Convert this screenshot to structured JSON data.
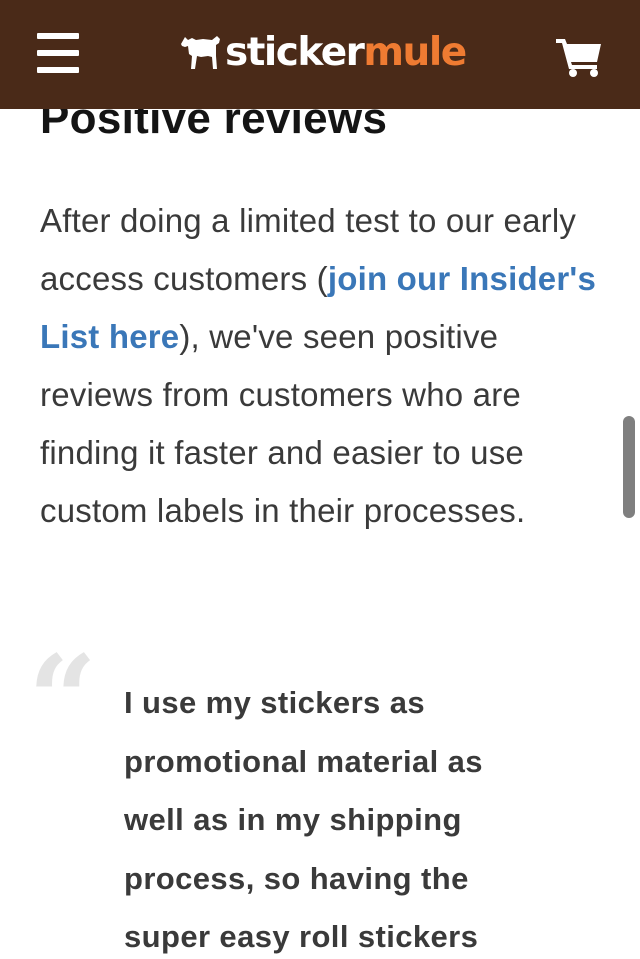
{
  "header": {
    "menu_icon": "hamburger-menu-icon",
    "logo": {
      "icon": "mule-icon",
      "word_sticker": "sticker",
      "word_mule": "mule"
    },
    "cart_icon": "shopping-cart-icon",
    "colors": {
      "background": "#4a2a18",
      "logo_accent": "#ef7b32",
      "foreground": "#ffffff"
    }
  },
  "article": {
    "heading": "Positive reviews",
    "paragraph": {
      "before_link": "After doing a limited test to our early access customers (",
      "link_text": "join our Insider's List here",
      "after_link": "), we've seen positive reviews from customers who are finding it faster and easier to use custom labels in their processes."
    },
    "quote": {
      "mark": "“",
      "text": "I use my stickers as promotional material as well as in my shipping process, so having the super easy roll stickers"
    },
    "colors": {
      "link": "#3a77b8",
      "text": "#3a3a3a",
      "heading": "#141414"
    }
  }
}
